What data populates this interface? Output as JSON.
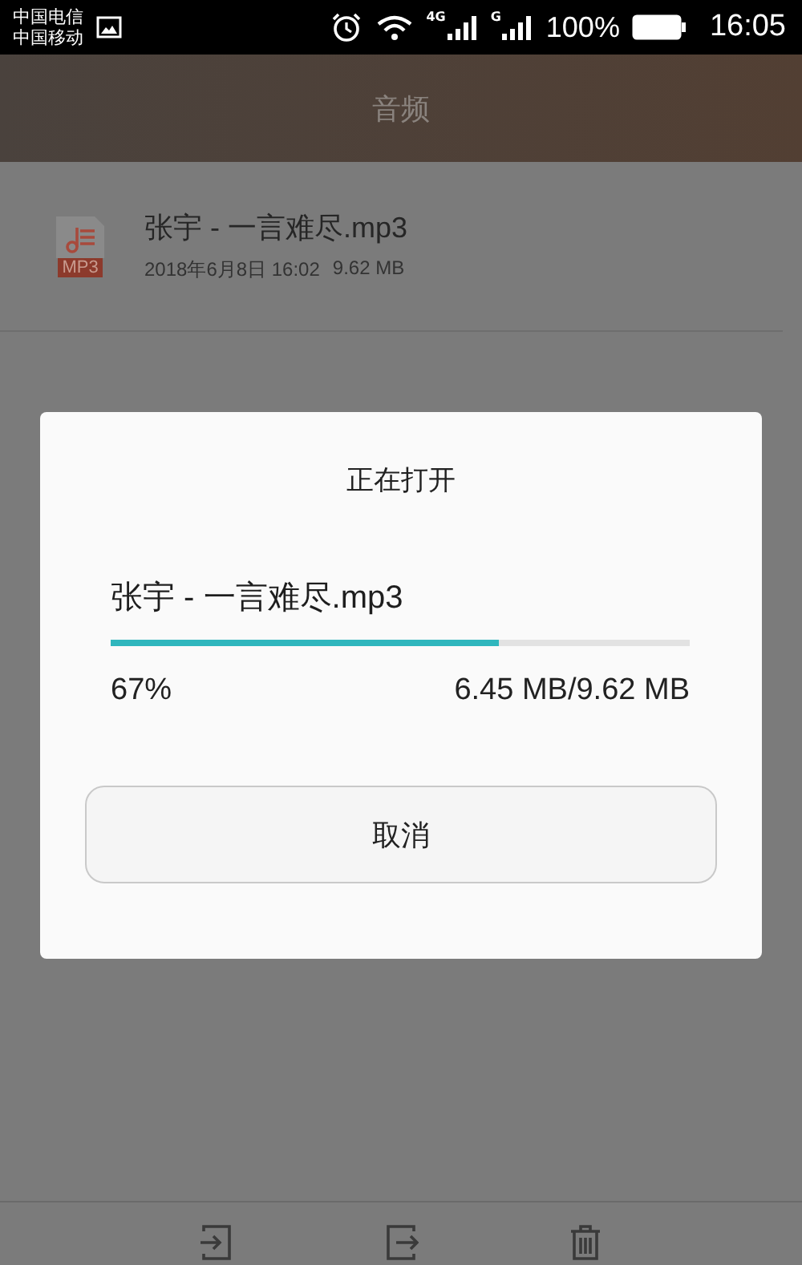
{
  "status_bar": {
    "carriers": [
      "中国电信",
      "中国移动"
    ],
    "networks": [
      {
        "label": "4G"
      },
      {
        "label": "G"
      }
    ],
    "battery": "100%",
    "time": "16:05"
  },
  "header": {
    "title": "音频"
  },
  "files": [
    {
      "badge": "MP3",
      "name": "张宇 - 一言难尽.mp3",
      "date": "2018年6月8日 16:02",
      "size": "9.62 MB"
    }
  ],
  "dialog": {
    "title": "正在打开",
    "file_name": "张宇 - 一言难尽.mp3",
    "level": 0.67,
    "percent": "67%",
    "amount": "6.45 MB/9.62 MB",
    "button": "取消"
  },
  "toolbar": [
    {
      "kind": "move-in"
    },
    {
      "kind": "move-out"
    },
    {
      "kind": "delete"
    }
  ]
}
